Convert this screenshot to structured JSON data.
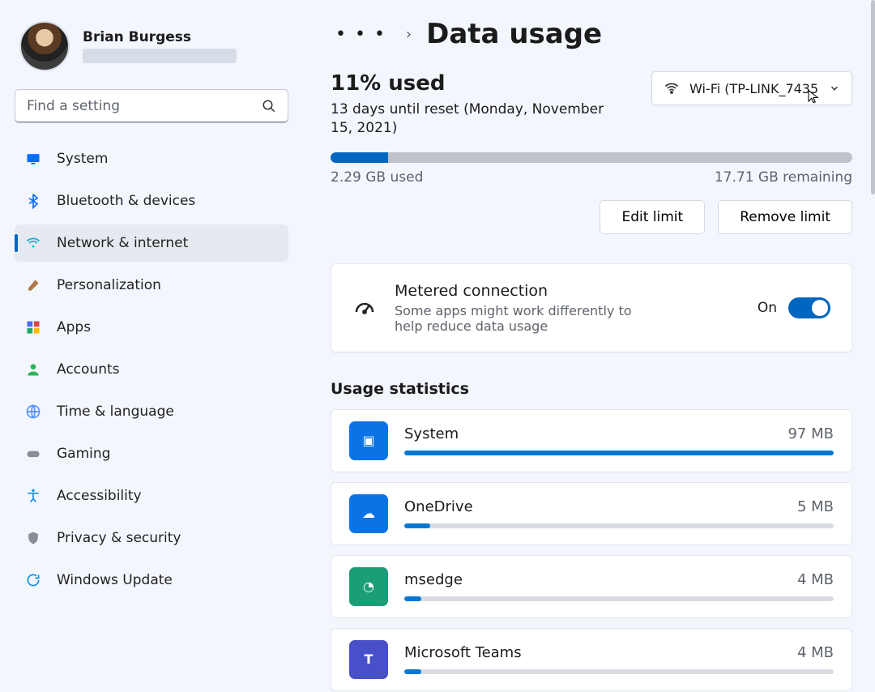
{
  "user": {
    "name": "Brian Burgess"
  },
  "search": {
    "placeholder": "Find a setting"
  },
  "sidebar": {
    "items": [
      {
        "label": "System",
        "icon": "display-icon",
        "color": "#0a6cff"
      },
      {
        "label": "Bluetooth & devices",
        "icon": "bluetooth-icon",
        "color": "#0a6cff"
      },
      {
        "label": "Network & internet",
        "icon": "wifi-icon",
        "color": "#17b1d0",
        "active": true
      },
      {
        "label": "Personalization",
        "icon": "paintbrush-icon",
        "color": "#b07848"
      },
      {
        "label": "Apps",
        "icon": "apps-icon",
        "color": "#4f6bed"
      },
      {
        "label": "Accounts",
        "icon": "person-icon",
        "color": "#2fb35b"
      },
      {
        "label": "Time & language",
        "icon": "globe-clock-icon",
        "color": "#4f92ff"
      },
      {
        "label": "Gaming",
        "icon": "gamepad-icon",
        "color": "#8a8d93"
      },
      {
        "label": "Accessibility",
        "icon": "accessibility-icon",
        "color": "#0d8ee9"
      },
      {
        "label": "Privacy & security",
        "icon": "shield-icon",
        "color": "#8a8d93"
      },
      {
        "label": "Windows Update",
        "icon": "update-icon",
        "color": "#0d8ee9"
      }
    ]
  },
  "crumbs": {
    "more": "• • •",
    "chevron": "›"
  },
  "page": {
    "title": "Data usage",
    "percent_used": "11% used",
    "reset_text": "13 days until reset (Monday, November 15, 2021)",
    "network_selector": "Wi-Fi (TP-LINK_7435",
    "progress_pct": 11,
    "used_label": "2.29 GB used",
    "remaining_label": "17.71 GB remaining",
    "edit_limit": "Edit limit",
    "remove_limit": "Remove limit"
  },
  "metered": {
    "title": "Metered connection",
    "subtitle": "Some apps might work differently to help reduce data usage",
    "state_label": "On",
    "on": true
  },
  "stats": {
    "heading": "Usage statistics",
    "apps": [
      {
        "name": "System",
        "value": "97 MB",
        "pct": 100,
        "color": "#0b73e6",
        "glyph": "▣"
      },
      {
        "name": "OneDrive",
        "value": "5 MB",
        "pct": 6,
        "color": "#0b73e6",
        "glyph": "☁"
      },
      {
        "name": "msedge",
        "value": "4 MB",
        "pct": 4,
        "color": "#1b9e77",
        "glyph": "◔"
      },
      {
        "name": "Microsoft Teams",
        "value": "4 MB",
        "pct": 4,
        "color": "#4750c8",
        "glyph": "T"
      }
    ]
  }
}
